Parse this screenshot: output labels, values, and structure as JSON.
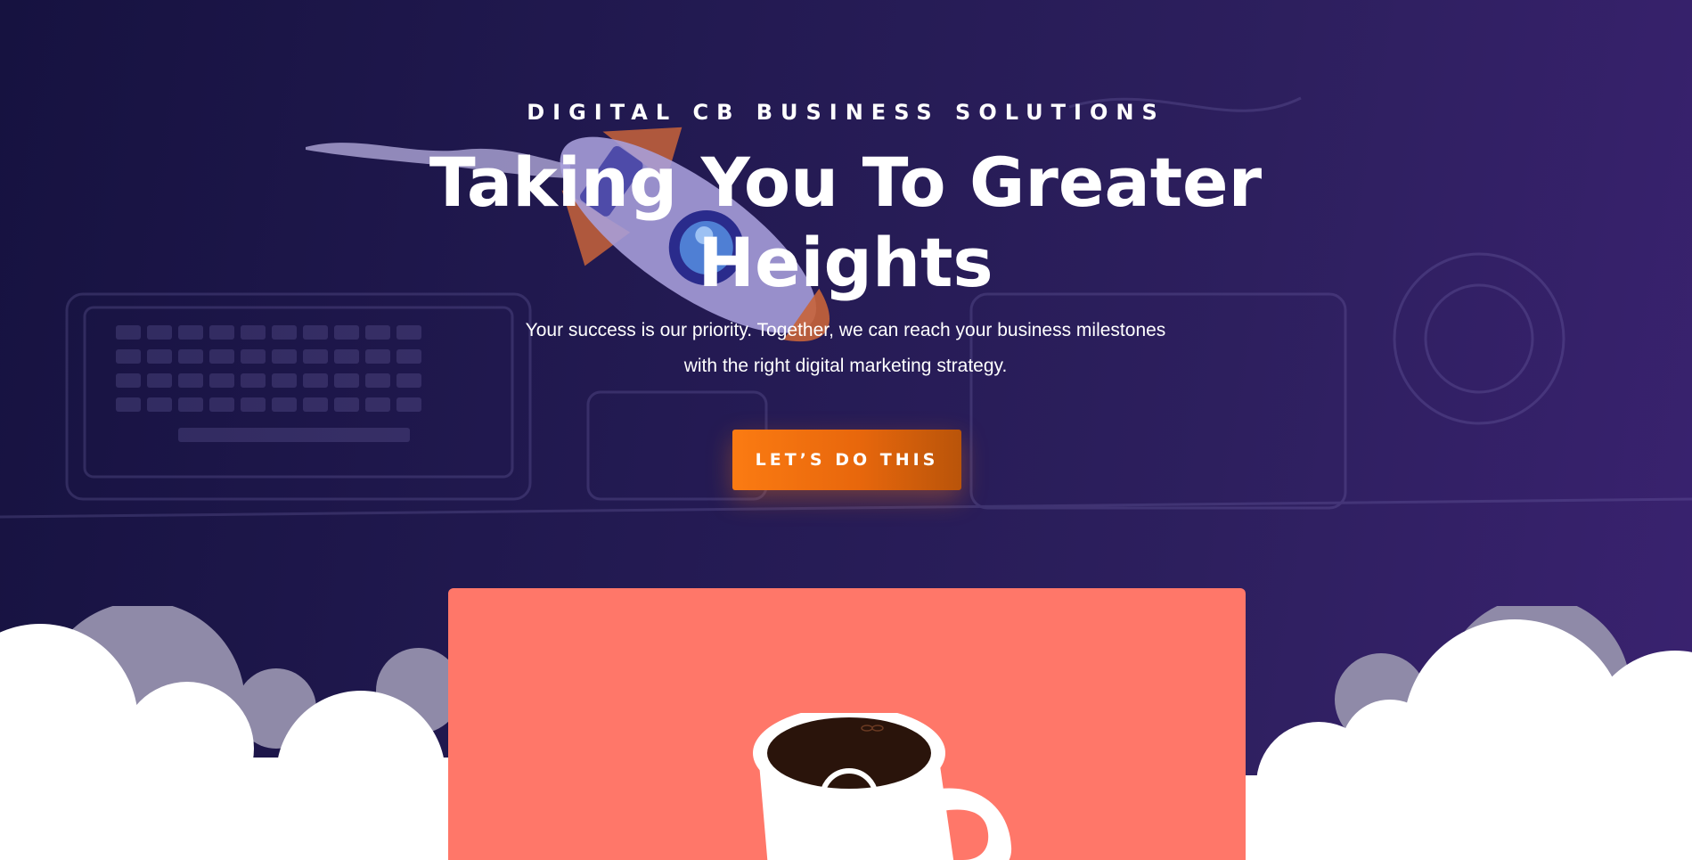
{
  "hero": {
    "eyebrow": "DIGITAL CB BUSINESS SOLUTIONS",
    "title": "Taking You To Greater Heights",
    "subtitle_line1": "Your success is our priority. Together, we can reach your business milestones",
    "subtitle_line2": "with the right digital marketing strategy.",
    "cta_label": "LET’S DO THIS"
  },
  "colors": {
    "background_start": "#161240",
    "background_end": "#3a2270",
    "accent": "#fb7b12",
    "card": "#ff7769",
    "text": "#ffffff"
  },
  "images": {
    "rocket": "rocket-illustration",
    "workspace": "desk-laptop-background",
    "mug": "coffee-mug-illustration",
    "clouds": "cloud-illustration"
  }
}
